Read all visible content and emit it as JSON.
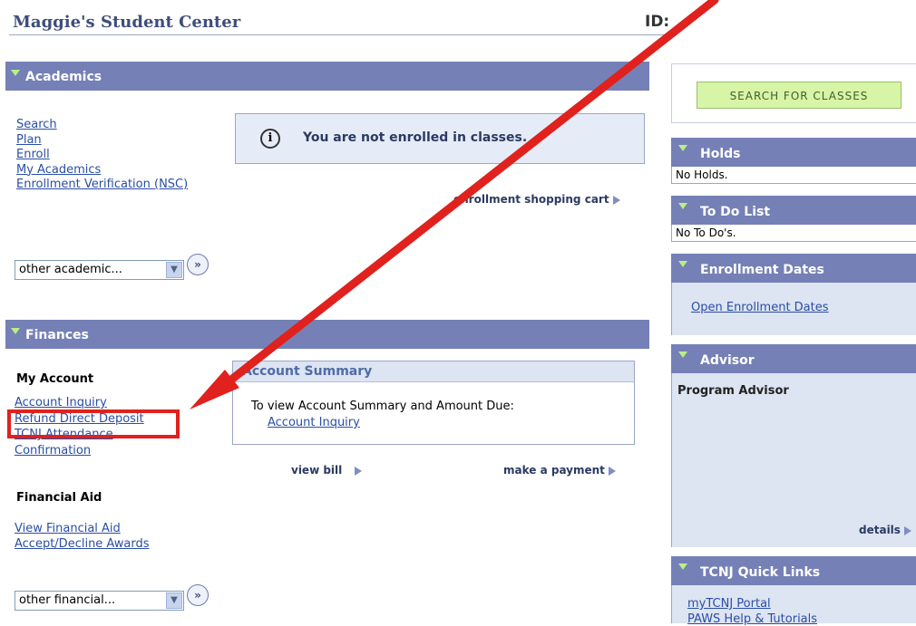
{
  "header": {
    "title": "Maggie's Student Center",
    "id_label": "ID:"
  },
  "academics": {
    "title": "Academics",
    "links": [
      "Search",
      "Plan",
      "Enroll",
      "My Academics",
      "Enrollment Verification (NSC)"
    ],
    "message": "You are not enrolled in classes.",
    "cart_link": "enrollment shopping cart",
    "other_select": "other academic..."
  },
  "finances": {
    "title": "Finances",
    "my_account_heading": "My Account",
    "account_links": [
      "Account Inquiry",
      "Refund Direct Deposit",
      "TCNJ Attendance",
      "Confirmation"
    ],
    "fin_aid_heading": "Financial Aid",
    "fin_aid_links": [
      "View Financial Aid",
      "Accept/Decline Awards"
    ],
    "other_select": "other financial...",
    "summary": {
      "title": "Account Summary",
      "text": "To view Account Summary and Amount Due:",
      "link": "Account Inquiry"
    },
    "view_bill": "view bill",
    "make_payment": "make a payment"
  },
  "sidebar": {
    "search_button": "Search for Classes",
    "holds": {
      "title": "Holds",
      "text": "No Holds."
    },
    "todo": {
      "title": "To Do List",
      "text": "No To Do's."
    },
    "enrollment_dates": {
      "title": "Enrollment Dates",
      "link": "Open Enrollment Dates"
    },
    "advisor": {
      "title": "Advisor",
      "label": "Program Advisor",
      "details": "details"
    },
    "quick_links": {
      "title": "TCNJ Quick Links",
      "links": [
        "myTCNJ Portal",
        "PAWS Help & Tutorials"
      ]
    }
  },
  "annotation": {
    "arrow_color": "#e0211d"
  }
}
